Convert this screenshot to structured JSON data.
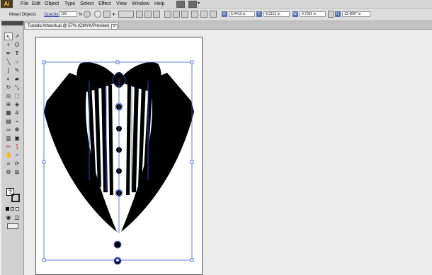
{
  "app": {
    "logo": "Ai"
  },
  "menu": [
    "File",
    "Edit",
    "Object",
    "Type",
    "Select",
    "Effect",
    "View",
    "Window",
    "Help"
  ],
  "control_bar": {
    "selection_label": "Mixed Objects",
    "opacity_label": "Opacity:",
    "opacity_value": "100",
    "opacity_unit": "%",
    "x_label": "X:",
    "x_value": "5,4412 in",
    "y_label": "Y:",
    "y_value": "8,3151 in",
    "w_label": "W:",
    "w_value": "9,7961 in",
    "h_label": "H:",
    "h_value": "13,4007 in"
  },
  "document": {
    "tab_title": "Tuxedo Artwork.ai @ 57% (CMYK/Preview)",
    "close_glyph": "×"
  },
  "colors": {
    "artwork": "#000000",
    "selection": "#3b5bd6",
    "toolbox_bg": "#d0d0d0",
    "menubar_bg": "#d6d6d6"
  }
}
